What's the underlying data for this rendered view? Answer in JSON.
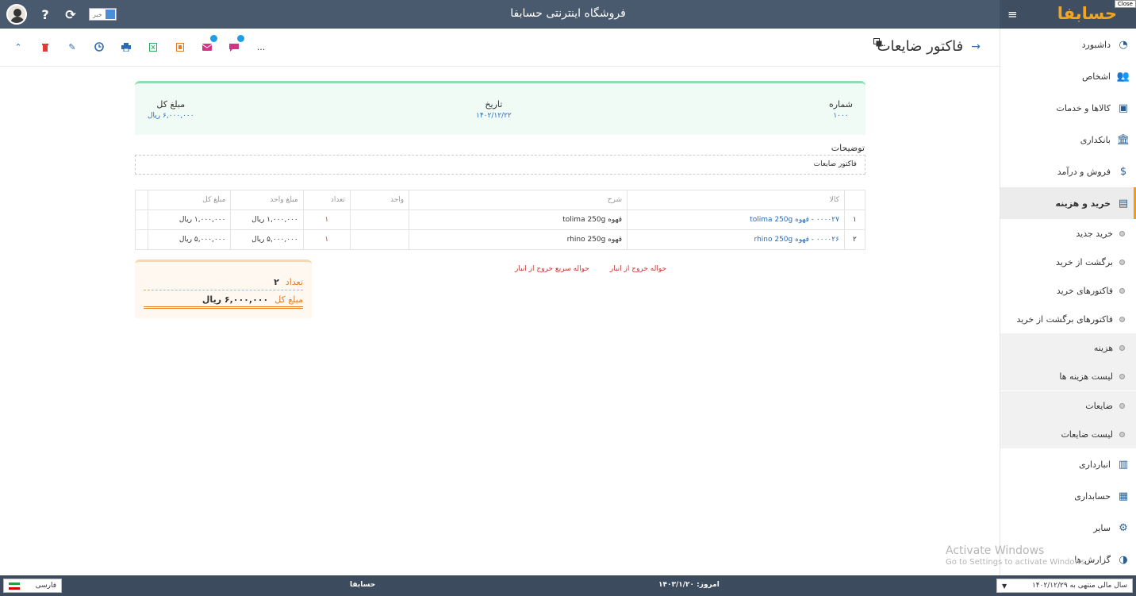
{
  "app": {
    "title": "فروشگاه اینترنتی حسابفا",
    "logo": "حسابفا",
    "close_tag": "Close",
    "news_label": "خبر"
  },
  "sidebar": {
    "items": [
      {
        "label": "داشبورد",
        "icon": "dashboard-icon"
      },
      {
        "label": "اشخاص",
        "icon": "people-icon"
      },
      {
        "label": "کالاها و خدمات",
        "icon": "box-icon"
      },
      {
        "label": "بانکداری",
        "icon": "bank-icon"
      },
      {
        "label": "فروش و درآمد",
        "icon": "sales-icon"
      },
      {
        "label": "خرید و هزینه",
        "icon": "wallet-icon"
      }
    ],
    "sub_group1": [
      "خرید جدید",
      "برگشت از خرید",
      "فاکتورهای خرید",
      "فاکتورهای برگشت از خرید"
    ],
    "sub_group2": [
      "هزینه",
      "لیست هزینه ها"
    ],
    "sub_group3": [
      "ضایعات",
      "لیست ضایعات"
    ],
    "bottom_items": [
      {
        "label": "انبارداری",
        "icon": "warehouse-icon"
      },
      {
        "label": "حسابداری",
        "icon": "accounting-icon"
      },
      {
        "label": "سایر",
        "icon": "other-icon"
      },
      {
        "label": "گزارش ها",
        "icon": "reports-icon"
      }
    ]
  },
  "page": {
    "title": "فاکتور ضایعات",
    "more": "..."
  },
  "summary": {
    "number_label": "شماره",
    "number_value": "۱۰۰۰",
    "date_label": "تاریخ",
    "date_value": "۱۴۰۲/۱۲/۲۲",
    "total_label": "مبلغ کل",
    "total_value": "۶,۰۰۰,۰۰۰ ریال"
  },
  "description": {
    "label": "توضیحات",
    "value": "فاکتور ضایعات"
  },
  "table": {
    "headers": [
      "کالا",
      "شرح",
      "واحد",
      "تعداد",
      "مبلغ واحد",
      "مبلغ کل"
    ],
    "rows": [
      {
        "idx": "۱",
        "item": "۰۰۰۰۲۷ - قهوه tolima 250g",
        "desc": "قهوه tolima 250g",
        "unit": "",
        "qty": "۱",
        "unit_price": "۱,۰۰۰,۰۰۰ ریال",
        "total": "۱,۰۰۰,۰۰۰ ریال"
      },
      {
        "idx": "۲",
        "item": "۰۰۰۰۲۶ - قهوه rhino 250g",
        "desc": "قهوه rhino 250g",
        "unit": "",
        "qty": "۱",
        "unit_price": "۵,۰۰۰,۰۰۰ ریال",
        "total": "۵,۰۰۰,۰۰۰ ریال"
      }
    ]
  },
  "totals": {
    "count_label": "تعداد",
    "count_value": "۲",
    "sum_label": "مبلغ کل",
    "sum_value": "۶,۰۰۰,۰۰۰ ریال"
  },
  "links": {
    "warehouse_exit": "حواله خروج از انبار",
    "quick_exit": "حواله سریع خروج از انبار"
  },
  "watermark": {
    "line1": "Activate Windows",
    "line2": "Go to Settings to activate Windows."
  },
  "footer": {
    "language": "فارسی",
    "brand": "حسابفا",
    "today": "امروز: ۱۴۰۳/۱/۲۰",
    "fiscal_year": "سال مالی منتهی به ۱۴۰۲/۱۲/۲۹"
  },
  "colors": {
    "topbar": "#4a5a6e",
    "accent": "#f39c12",
    "link": "#2b6bb3",
    "danger": "#c0392b"
  }
}
